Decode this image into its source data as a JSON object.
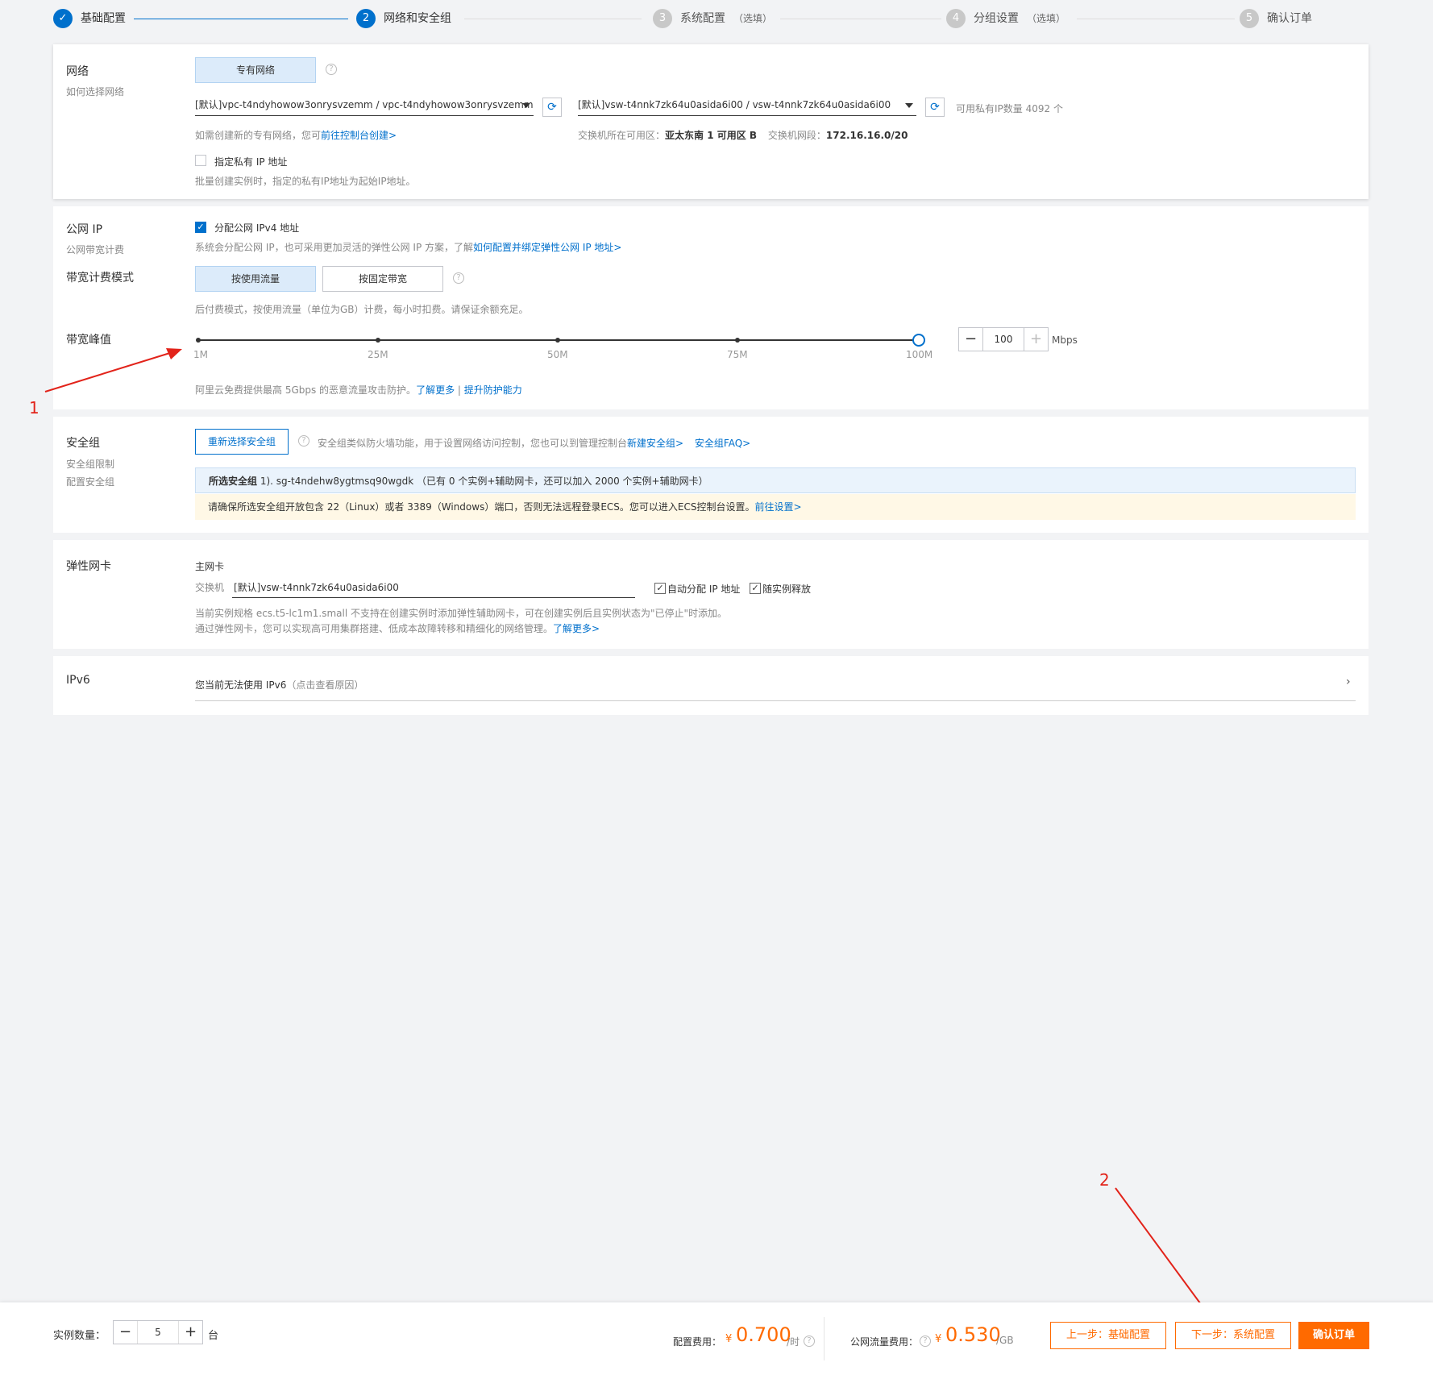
{
  "steps": [
    {
      "num": "✓",
      "label": "基础配置",
      "optional": ""
    },
    {
      "num": "2",
      "label": "网络和安全组",
      "optional": ""
    },
    {
      "num": "3",
      "label": "系统配置",
      "optional": "（选填）"
    },
    {
      "num": "4",
      "label": "分组设置",
      "optional": "（选填）"
    },
    {
      "num": "5",
      "label": "确认订单",
      "optional": ""
    }
  ],
  "network": {
    "title": "网络",
    "subtitle": "如何选择网络",
    "type_button": "专有网络",
    "vpc_select": "[默认]vpc-t4ndyhowow3onrysvzemm / vpc-t4ndyhowow3onrysvzemm",
    "vswitch_select": "[默认]vsw-t4nnk7zk64u0asida6i00 / vsw-t4nnk7zk64u0asida6i00",
    "available_ip": "可用私有IP数量 4092 个",
    "create_hint": "如需创建新的专有网络，您可",
    "create_link": "前往控制台创建>",
    "zone_label": "交换机所在可用区：",
    "zone_value": "亚太东南 1 可用区 B",
    "cidr_label": "交换机网段：",
    "cidr_value": "172.16.16.0/20",
    "private_ip_label": "指定私有 IP 地址",
    "private_ip_hint": "批量创建实例时，指定的私有IP地址为起始IP地址。"
  },
  "public_ip": {
    "title": "公网 IP",
    "subtitle": "公网带宽计费",
    "assign_label": "分配公网 IPv4 地址",
    "assign_hint": "系统会分配公网 IP，也可采用更加灵活的弹性公网 IP 方案，了解",
    "assign_link": "如何配置并绑定弹性公网 IP 地址>",
    "billing_title": "带宽计费模式",
    "billing_options": [
      "按使用流量",
      "按固定带宽"
    ],
    "billing_hint": "后付费模式，按使用流量（单位为GB）计费，每小时扣费。请保证余额充足。",
    "peak_title": "带宽峰值",
    "slider_ticks": [
      "1M",
      "25M",
      "50M",
      "75M",
      "100M"
    ],
    "slider_value": 100,
    "bandwidth_value": "100",
    "bandwidth_unit": "Mbps",
    "ddos_hint": "阿里云免费提供最高 5Gbps 的恶意流量攻击防护。",
    "ddos_link1": "了解更多",
    "ddos_sep": "|",
    "ddos_link2": "提升防护能力"
  },
  "security_group": {
    "title": "安全组",
    "sub1": "安全组限制",
    "sub2": "配置安全组",
    "reselect_button": "重新选择安全组",
    "desc": "安全组类似防火墙功能，用于设置网络访问控制，您也可以到管理控制台",
    "new_link": "新建安全组>",
    "faq_link": "安全组FAQ>",
    "selected_label": "所选安全组",
    "selected_value": "1). sg-t4ndehw8ygtmsq90wgdk （已有 0 个实例+辅助网卡，还可以加入 2000 个实例+辅助网卡）",
    "warning": "请确保所选安全组开放包含 22（Linux）或者 3389（Windows）端口，否则无法远程登录ECS。您可以进入ECS控制台设置。",
    "warning_link": "前往设置>"
  },
  "eni": {
    "title": "弹性网卡",
    "primary": "主网卡",
    "switch_label": "交换机",
    "switch_value": "[默认]vsw-t4nnk7zk64u0asida6i00",
    "auto_ip": "自动分配 IP 地址",
    "release": "随实例释放",
    "hint1": "当前实例规格 ecs.t5-lc1m1.small 不支持在创建实例时添加弹性辅助网卡，可在创建实例后且实例状态为\"已停止\"时添加。",
    "hint2": "通过弹性网卡，您可以实现高可用集群搭建、低成本故障转移和精细化的网络管理。",
    "hint2_link": "了解更多>"
  },
  "ipv6": {
    "title": "IPv6",
    "text": "您当前无法使用 IPv6",
    "note": "（点击查看原因）"
  },
  "footer": {
    "count_label": "实例数量：",
    "count_value": "5",
    "count_unit": "台",
    "config_fee_label": "配置费用：",
    "config_fee_currency": "¥",
    "config_fee_value": "0.700",
    "config_fee_unit": "/时",
    "traffic_fee_label": "公网流量费用：",
    "traffic_fee_currency": "¥",
    "traffic_fee_value": "0.530",
    "traffic_fee_unit": "/GB",
    "prev_button": "上一步：基础配置",
    "next_button": "下一步：系统配置",
    "confirm_button": "确认订单"
  },
  "annotations": [
    "1",
    "2"
  ],
  "colors": {
    "primary": "#0070cc",
    "orange": "#ff6a00",
    "annotation": "#e2231a"
  }
}
